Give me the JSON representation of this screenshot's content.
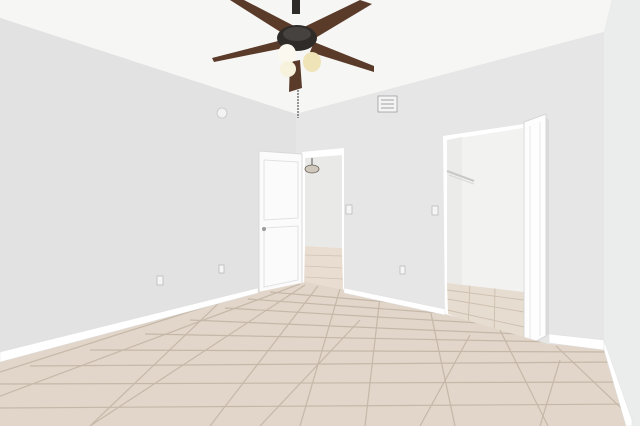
{
  "scene": {
    "description_type": "photo",
    "colors": {
      "ceiling": "#f6f6f5",
      "wall_left": "#e2e3e2",
      "wall_back": "#e6e7e6",
      "wall_right": "#eceded",
      "floor": "#e1d7cb",
      "grout": "#c8bcae",
      "trim": "#ffffff",
      "fan_blade": "#5a3b2a",
      "fan_metal": "#2e2b29",
      "closet_wall": "#f2f2f1",
      "hall_wall": "#e9e9e8"
    },
    "icons": [
      "ceiling-fan-icon",
      "light-bulb-icon",
      "vent-icon",
      "outlet-icon",
      "light-switch-icon",
      "smoke-detector-icon",
      "door-icon"
    ]
  }
}
